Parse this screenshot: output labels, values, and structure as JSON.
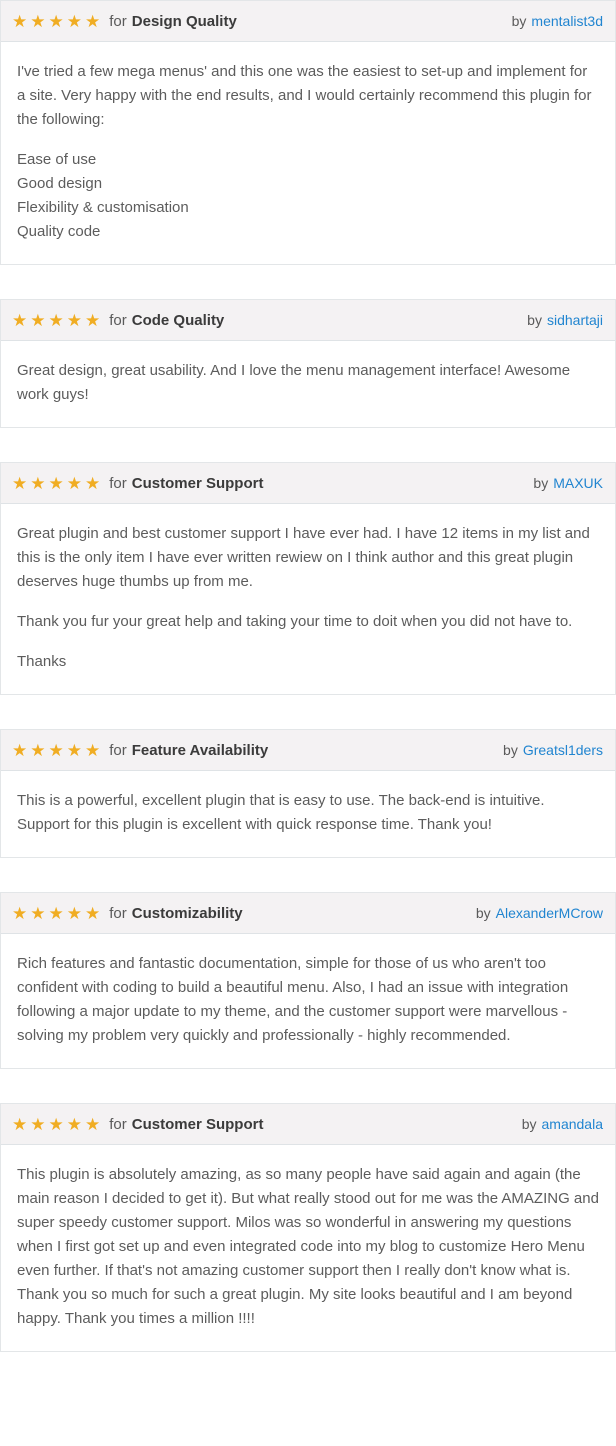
{
  "labels": {
    "for": "for",
    "by": "by",
    "star_glyph": "★"
  },
  "colors": {
    "star": "#f0ad23",
    "link": "#2185d0",
    "header_bg": "#f4f2f3",
    "border": "#e3e6e8",
    "text": "#5c5c5c"
  },
  "reviews": [
    {
      "rating": 5,
      "category": "Design Quality",
      "author": "mentalist3d",
      "paragraphs": [
        "I've tried a few mega menus' and this one was the easiest to set-up and implement for a site. Very happy with the end results, and I would certainly recommend this plugin for the following:"
      ],
      "list": [
        "Ease of use",
        "Good design",
        "Flexibility & customisation",
        "Quality code"
      ]
    },
    {
      "rating": 5,
      "category": "Code Quality",
      "author": "sidhartaji",
      "paragraphs": [
        "Great design, great usability. And I love the menu management interface! Awesome work guys!"
      ],
      "list": []
    },
    {
      "rating": 5,
      "category": "Customer Support",
      "author": "MAXUK",
      "paragraphs": [
        "Great plugin and best customer support I have ever had. I have 12 items in my list and this is the only item I have ever written rewiew on I think author and this great plugin deserves huge thumbs up from me.",
        "Thank you fur your great help and taking your time to doit when you did not have to.",
        "Thanks"
      ],
      "list": []
    },
    {
      "rating": 5,
      "category": "Feature Availability",
      "author": "Greatsl1ders",
      "paragraphs": [
        "This is a powerful, excellent plugin that is easy to use. The back-end is intuitive. Support for this plugin is excellent with quick response time. Thank you!"
      ],
      "list": []
    },
    {
      "rating": 5,
      "category": "Customizability",
      "author": "AlexanderMCrow",
      "paragraphs": [
        "Rich features and fantastic documentation, simple for those of us who aren't too confident with coding to build a beautiful menu. Also, I had an issue with integration following a major update to my theme, and the customer support were marvellous - solving my problem very quickly and professionally - highly recommended."
      ],
      "list": []
    },
    {
      "rating": 5,
      "category": "Customer Support",
      "author": "amandala",
      "paragraphs": [
        "This plugin is absolutely amazing, as so many people have said again and again (the main reason I decided to get it). But what really stood out for me was the AMAZING and super speedy customer support. Milos was so wonderful in answering my questions when I first got set up and even integrated code into my blog to customize Hero Menu even further. If that's not amazing customer support then I really don't know what is. Thank you so much for such a great plugin. My site looks beautiful and I am beyond happy. Thank you times a million !!!!"
      ],
      "list": []
    }
  ]
}
